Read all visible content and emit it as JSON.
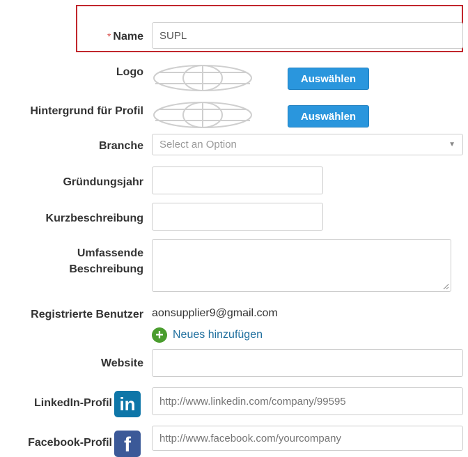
{
  "form": {
    "name": {
      "required_marker": "*",
      "label": "Name",
      "value": "SUPL"
    },
    "logo": {
      "label": "Logo",
      "button": "Auswählen",
      "icon": "globe-placeholder-icon"
    },
    "background": {
      "label": "Hintergrund für Profil",
      "button": "Auswählen",
      "icon": "globe-placeholder-icon"
    },
    "branche": {
      "label": "Branche",
      "placeholder": "Select an Option"
    },
    "gruendungsjahr": {
      "label": "Gründungsjahr",
      "value": ""
    },
    "kurzbeschreibung": {
      "label": "Kurzbeschreibung",
      "value": ""
    },
    "umfassende": {
      "label_line1": "Umfassende",
      "label_line2": "Beschreibung",
      "value": ""
    },
    "registered_users": {
      "label": "Registrierte Benutzer",
      "email": "aonsupplier9@gmail.com",
      "add_link": "Neues hinzufügen",
      "add_icon": "plus-circle-icon"
    },
    "website": {
      "label": "Website",
      "value": ""
    },
    "linkedin": {
      "label": "LinkedIn-Profil",
      "icon_glyph": "in",
      "placeholder": "http://www.linkedin.com/company/99595"
    },
    "facebook": {
      "label": "Facebook-Profil",
      "icon_glyph": "f",
      "placeholder": "http://www.facebook.com/yourcompany"
    }
  },
  "colors": {
    "highlight_border": "#c1272d",
    "button_bg": "#2a96dd",
    "linkedin": "#0e76a8",
    "facebook": "#3b5998",
    "add_green": "#4a9d2e",
    "link": "#1f6f9e"
  }
}
